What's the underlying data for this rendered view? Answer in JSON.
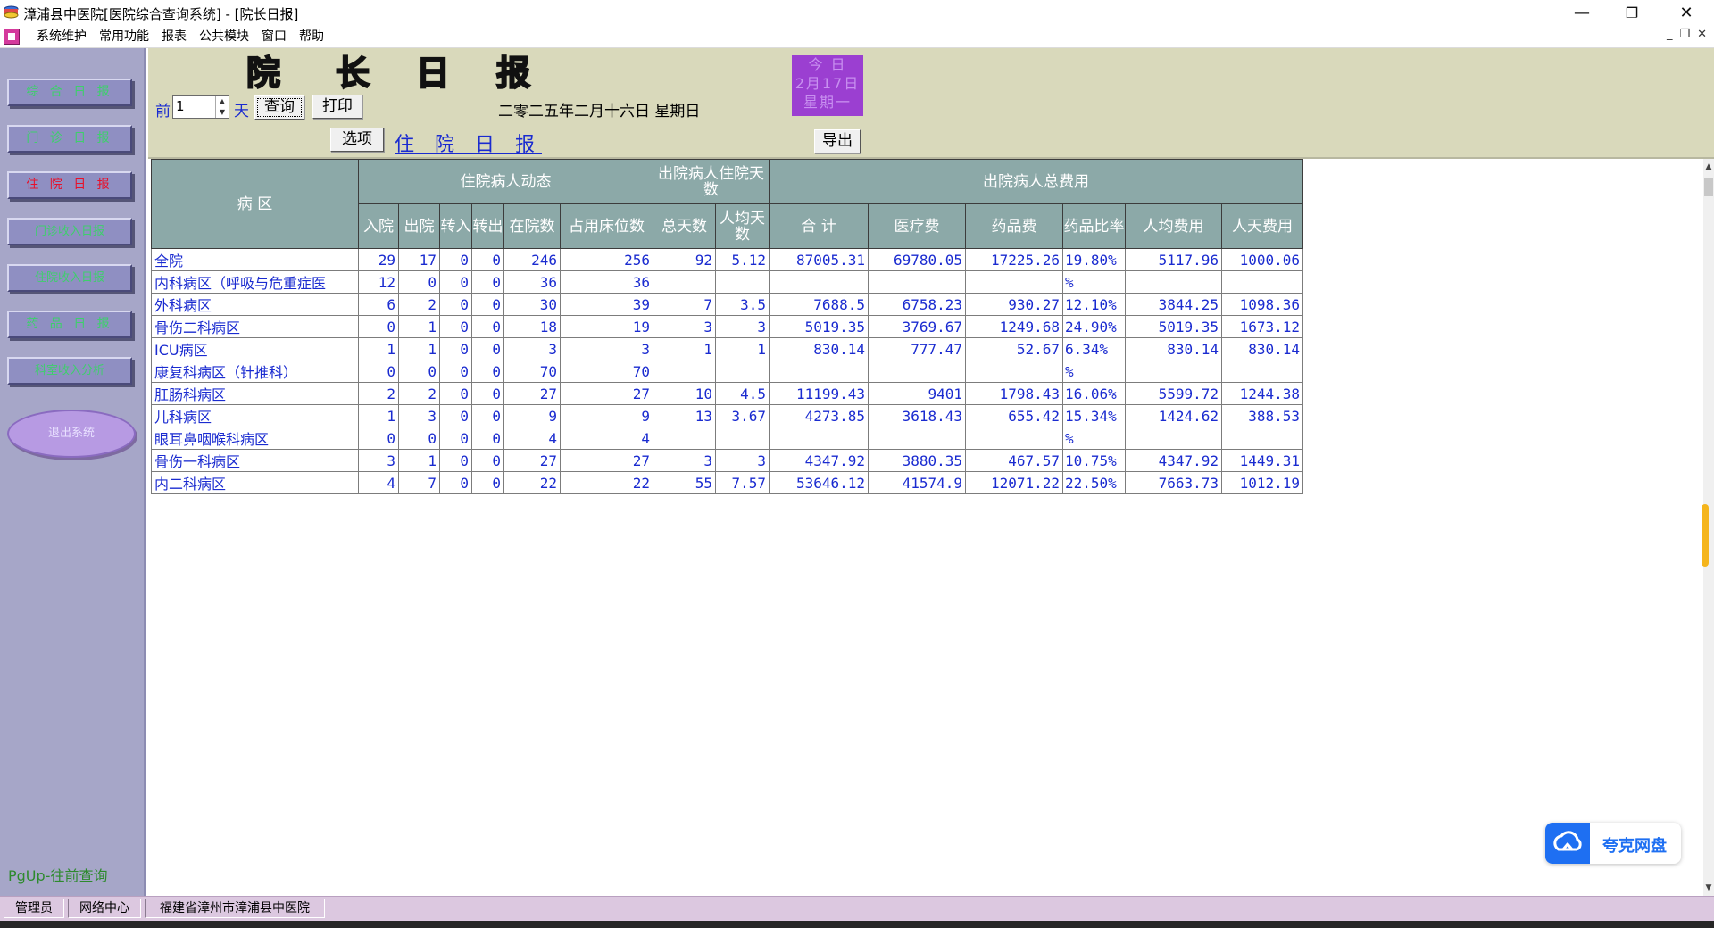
{
  "window": {
    "title": "漳浦县中医院[医院综合查询系统] - [院长日报]",
    "minimize": "—",
    "maximize": "❐",
    "close": "✕"
  },
  "menu": {
    "items": [
      "系统维护",
      "常用功能",
      "报表",
      "公共模块",
      "窗口",
      "帮助"
    ],
    "mdi_min": "_",
    "mdi_restore": "❐",
    "mdi_close": "✕"
  },
  "sidebar": {
    "buttons": [
      {
        "label": "综 合 日 报",
        "active": false
      },
      {
        "label": "门 诊 日 报",
        "active": false
      },
      {
        "label": "住 院 日 报",
        "active": true
      },
      {
        "label": "门诊收入日报",
        "active": false
      },
      {
        "label": "住院收入日报",
        "active": false
      },
      {
        "label": "药 品 日 报",
        "active": false
      },
      {
        "label": "科室收入分析",
        "active": false
      }
    ],
    "oval_label": "退出系统",
    "pgup_hint": "PgUp-往前查询"
  },
  "toolbar": {
    "title_chars": [
      "院",
      "长",
      "日",
      "报"
    ],
    "prefix_label": "前",
    "days_value": "1",
    "suffix_label": "天",
    "query_label": "查询",
    "print_label": "打印",
    "date_text": "二零二五年二月十六日   星期日",
    "today": {
      "line1": "今 日",
      "line2": "2月17日",
      "line3": "星期一"
    },
    "options_label": "选项",
    "report_link": "住 院 日 报",
    "export_label": "导出"
  },
  "table": {
    "group_headers": {
      "ward": "病    区",
      "dynamics": "住院病人动态",
      "discharge_days": "出院病人住院天数",
      "discharge_cost": "出院病人总费用"
    },
    "columns": {
      "admit": "入院",
      "discharge": "出院",
      "transfer_in": "转入",
      "transfer_out": "转出",
      "in_hospital": "在院数",
      "beds_occupied": "占用床位数",
      "total_days": "总天数",
      "avg_days": "人均天数",
      "total": "合    计",
      "medical": "医疗费",
      "drug": "药品费",
      "drug_ratio": "药品比率",
      "per_capita": "人均费用",
      "per_day": "人天费用"
    },
    "rows": [
      {
        "name": "全院",
        "admit": "29",
        "discharge": "17",
        "tin": "0",
        "tout": "0",
        "inh": "246",
        "beds": "256",
        "days": "92",
        "avg": "5.12",
        "total": "87005.31",
        "med": "69780.05",
        "drug": "17225.26",
        "ratio": "19.80%",
        "percap": "5117.96",
        "perday": "1000.06"
      },
      {
        "name": "内科病区（呼吸与危重症医",
        "admit": "12",
        "discharge": "0",
        "tin": "0",
        "tout": "0",
        "inh": "36",
        "beds": "36",
        "days": "",
        "avg": "",
        "total": "",
        "med": "",
        "drug": "",
        "ratio": "%",
        "percap": "",
        "perday": ""
      },
      {
        "name": "外科病区",
        "admit": "6",
        "discharge": "2",
        "tin": "0",
        "tout": "0",
        "inh": "30",
        "beds": "39",
        "days": "7",
        "avg": "3.5",
        "total": "7688.5",
        "med": "6758.23",
        "drug": "930.27",
        "ratio": "12.10%",
        "percap": "3844.25",
        "perday": "1098.36"
      },
      {
        "name": "骨伤二科病区",
        "admit": "0",
        "discharge": "1",
        "tin": "0",
        "tout": "0",
        "inh": "18",
        "beds": "19",
        "days": "3",
        "avg": "3",
        "total": "5019.35",
        "med": "3769.67",
        "drug": "1249.68",
        "ratio": "24.90%",
        "percap": "5019.35",
        "perday": "1673.12"
      },
      {
        "name": "ICU病区",
        "admit": "1",
        "discharge": "1",
        "tin": "0",
        "tout": "0",
        "inh": "3",
        "beds": "3",
        "days": "1",
        "avg": "1",
        "total": "830.14",
        "med": "777.47",
        "drug": "52.67",
        "ratio": "6.34%",
        "percap": "830.14",
        "perday": "830.14"
      },
      {
        "name": "康复科病区（针推科）",
        "admit": "0",
        "discharge": "0",
        "tin": "0",
        "tout": "0",
        "inh": "70",
        "beds": "70",
        "days": "",
        "avg": "",
        "total": "",
        "med": "",
        "drug": "",
        "ratio": "%",
        "percap": "",
        "perday": ""
      },
      {
        "name": "肛肠科病区",
        "admit": "2",
        "discharge": "2",
        "tin": "0",
        "tout": "0",
        "inh": "27",
        "beds": "27",
        "days": "10",
        "avg": "4.5",
        "total": "11199.43",
        "med": "9401",
        "drug": "1798.43",
        "ratio": "16.06%",
        "percap": "5599.72",
        "perday": "1244.38"
      },
      {
        "name": "儿科病区",
        "admit": "1",
        "discharge": "3",
        "tin": "0",
        "tout": "0",
        "inh": "9",
        "beds": "9",
        "days": "13",
        "avg": "3.67",
        "total": "4273.85",
        "med": "3618.43",
        "drug": "655.42",
        "ratio": "15.34%",
        "percap": "1424.62",
        "perday": "388.53"
      },
      {
        "name": "眼耳鼻咽喉科病区",
        "admit": "0",
        "discharge": "0",
        "tin": "0",
        "tout": "0",
        "inh": "4",
        "beds": "4",
        "days": "",
        "avg": "",
        "total": "",
        "med": "",
        "drug": "",
        "ratio": "%",
        "percap": "",
        "perday": ""
      },
      {
        "name": "骨伤一科病区",
        "admit": "3",
        "discharge": "1",
        "tin": "0",
        "tout": "0",
        "inh": "27",
        "beds": "27",
        "days": "3",
        "avg": "3",
        "total": "4347.92",
        "med": "3880.35",
        "drug": "467.57",
        "ratio": "10.75%",
        "percap": "4347.92",
        "perday": "1449.31"
      },
      {
        "name": "内二科病区",
        "admit": "4",
        "discharge": "7",
        "tin": "0",
        "tout": "0",
        "inh": "22",
        "beds": "22",
        "days": "55",
        "avg": "7.57",
        "total": "53646.12",
        "med": "41574.9",
        "drug": "12071.22",
        "ratio": "22.50%",
        "percap": "7663.73",
        "perday": "1012.19"
      }
    ]
  },
  "cloud_widget": {
    "label": "夸克网盘",
    "icon": "cloud-icon"
  },
  "statusbar": {
    "user": "管理员",
    "center": "网络中心",
    "org": "福建省漳州市漳浦县中医院"
  },
  "colors": {
    "header_bg": "#8ca9a8",
    "cell_text": "#1a2bd0",
    "toolbar_bg": "#d9d9bb",
    "sidebar_bg": "#a6a6c8",
    "today_bg": "#9b3fd1"
  }
}
